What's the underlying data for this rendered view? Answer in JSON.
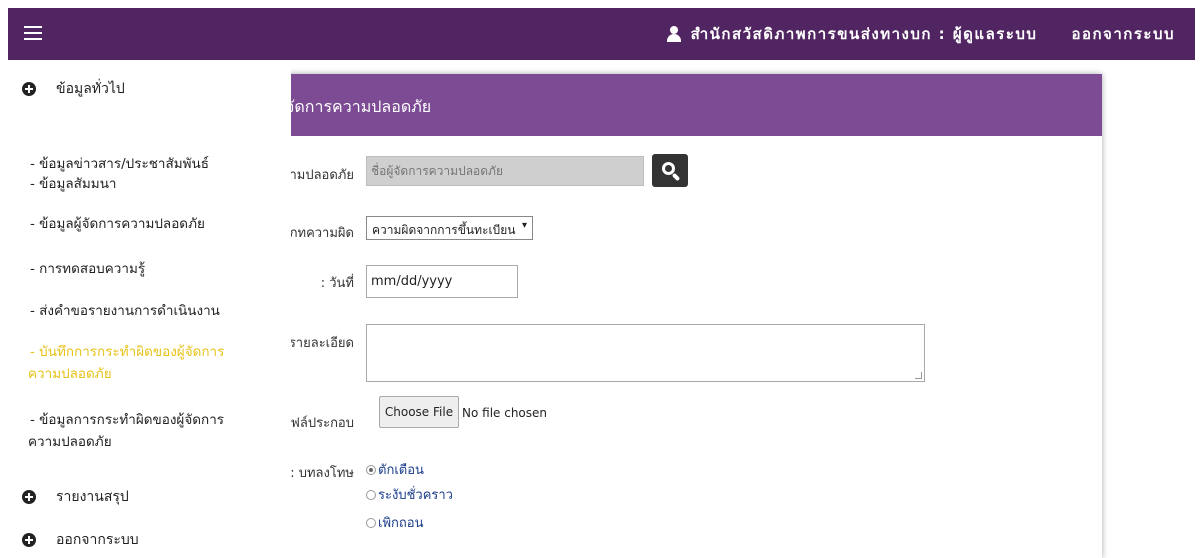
{
  "topbar": {
    "title": "สำนักสวัสดิภาพการขนส่งทางบก : ผู้ดูแลระบบ",
    "logout": "ออกจากระบบ",
    "bg_color": "#512561"
  },
  "sidebar": {
    "section_general": "ข้อมูลทั่วไป",
    "items": [
      {
        "line1": "- ข้อมูลข่าวสาร/ประชาสัมพันธ์",
        "line2": ""
      },
      {
        "line1": "- ข้อมูลสัมมนา",
        "line2": ""
      },
      {
        "line1": "- ข้อมูลผู้จัดการความปลอดภัย",
        "line2": ""
      },
      {
        "line1": "- การทดสอบความรู้",
        "line2": ""
      },
      {
        "line1": "- ส่งคำขอรายงานการดำเนินงาน",
        "line2": ""
      },
      {
        "line1": "- บันทึกการกระทำผิดของผู้จัดการ",
        "line2": "ความปลอดภัย"
      },
      {
        "line1": "- ข้อมูลการกระทำผิดของผู้จัดการ",
        "line2": "ความปลอดภัย"
      }
    ],
    "section_report": "รายงานสรุป",
    "section_logout": "ออกจากระบบ",
    "active_color": "#e7c21a"
  },
  "panel": {
    "header": "จัดการความปลอดภัย",
    "header_color": "#7c4b93",
    "fields": {
      "name_label": "ชื่อผู้จัดการความปลอดภัย :",
      "name_placeholder": "ชื่อผู้จัดการความปลอดภัย",
      "type_label": "ประเภทความผิด :",
      "type_value": "ความผิดจากการขึ้นทะเบียน",
      "date_label": "วันที่ :",
      "date_value": "mm/dd/yyyy",
      "detail_label": "รายละเอียด :",
      "file_label": "ไฟล์ประกอบ :",
      "file_button": "Choose File",
      "file_status": "No file chosen",
      "penalty_label": "บทลงโทษ :",
      "penalties": [
        "ตักเตือน",
        "ระงับชั่วคราว",
        "เพิกถอน"
      ]
    }
  }
}
